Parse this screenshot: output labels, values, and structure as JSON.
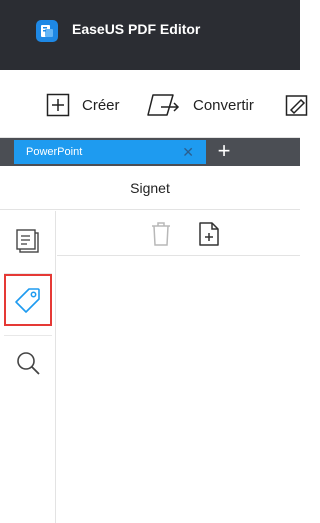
{
  "app": {
    "title": "EaseUS PDF Editor",
    "logo_icon": "easeus-pdf-logo"
  },
  "toolbar": {
    "create_label": "Créer",
    "convert_label": "Convertir",
    "create_icon": "plus-square-icon",
    "convert_icon": "convert-document-icon",
    "edit_icon": "edit-pencil-icon"
  },
  "tabs": [
    {
      "label": "PowerPoint",
      "active": true
    }
  ],
  "panel": {
    "title": "Signet",
    "rail": [
      {
        "icon": "thumbnails-icon",
        "active": false
      },
      {
        "icon": "bookmark-tag-icon",
        "active": true
      },
      {
        "icon": "search-icon",
        "active": false
      }
    ],
    "actions": [
      {
        "icon": "trash-icon",
        "enabled": false
      },
      {
        "icon": "add-page-icon",
        "enabled": true
      }
    ]
  },
  "colors": {
    "titlebar": "#2b2d33",
    "tab_active": "#1e9bf0",
    "accent": "#1e9bf0",
    "selection_border": "#e53935"
  }
}
